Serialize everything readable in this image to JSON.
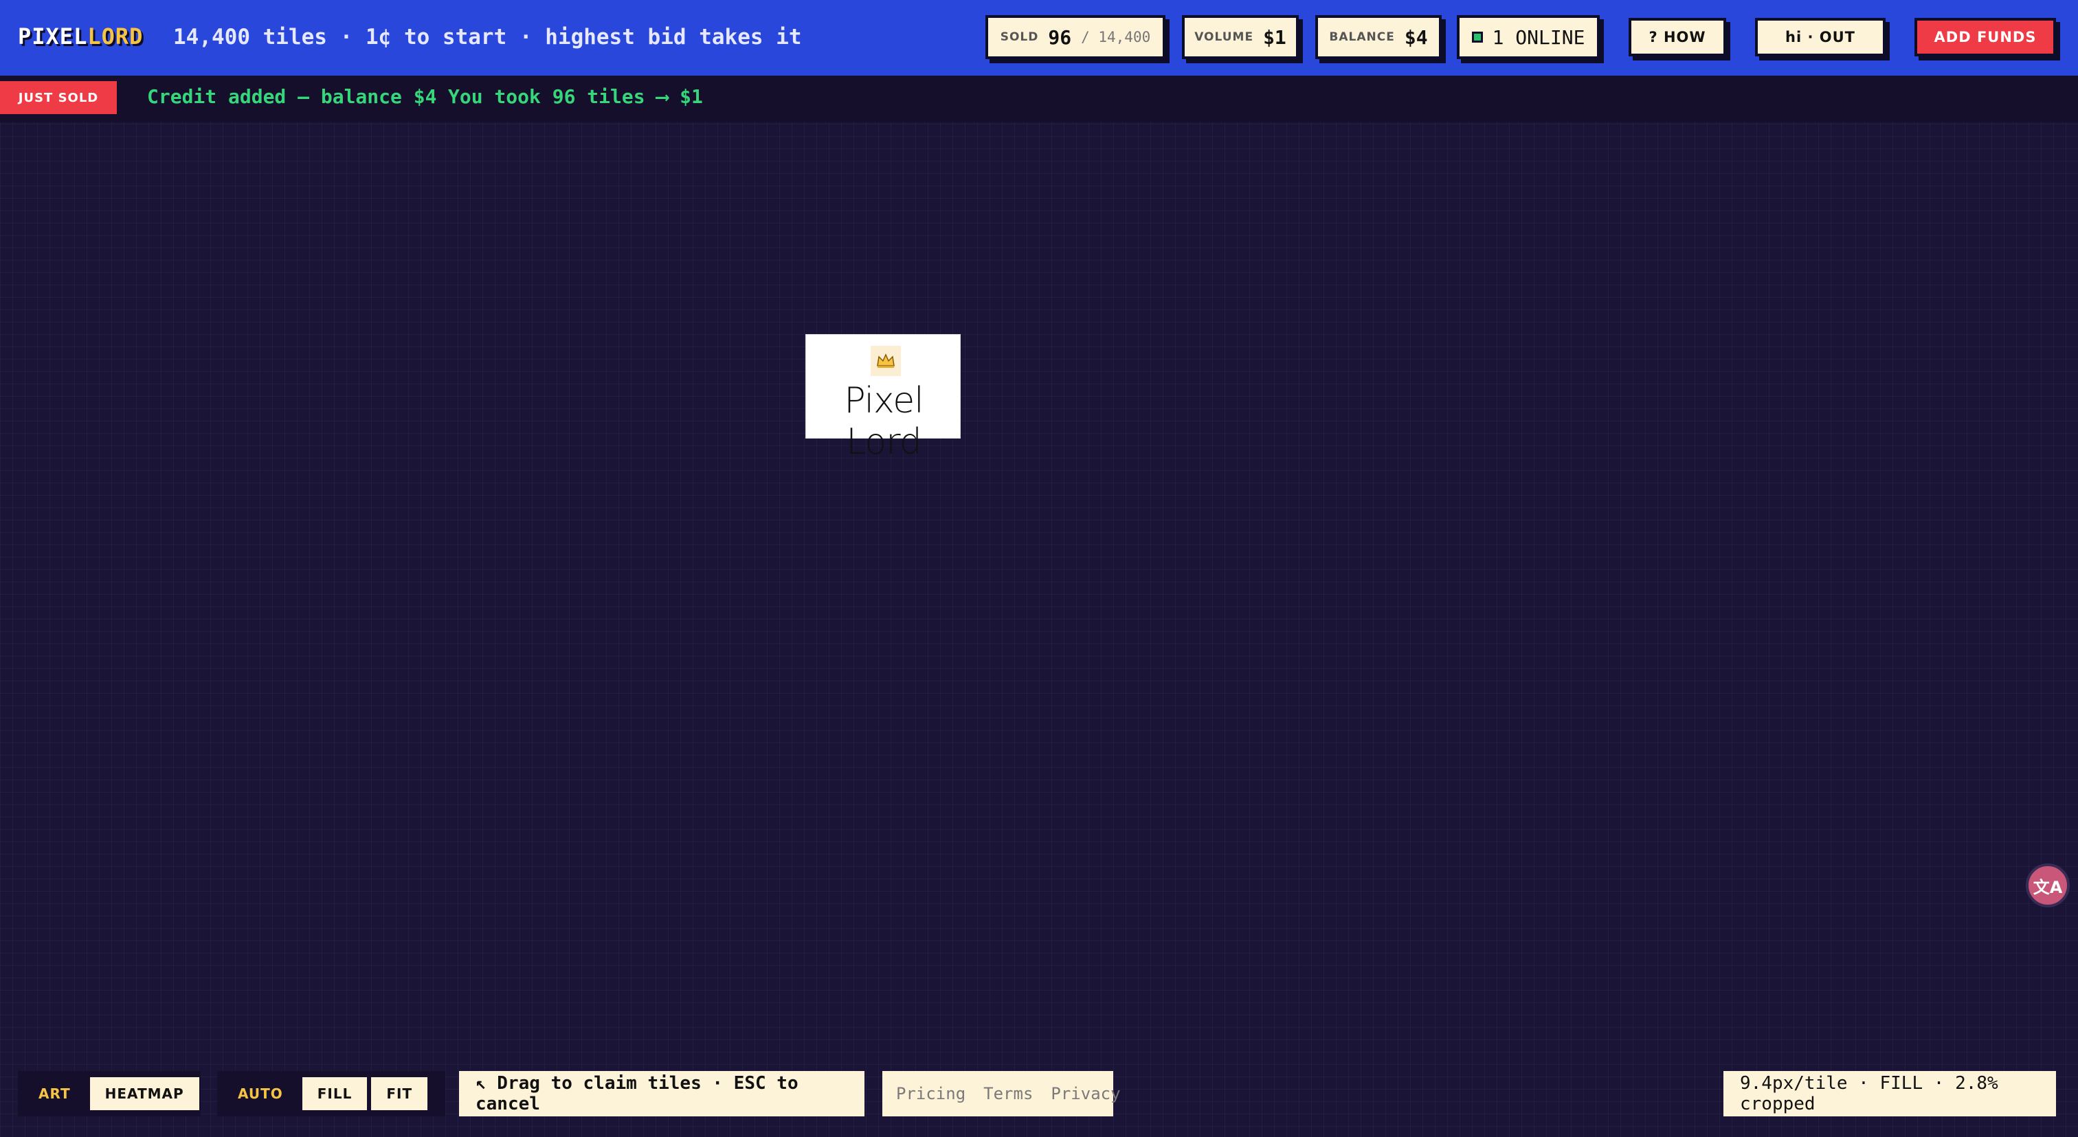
{
  "header": {
    "logo_part1": "PIXEL",
    "logo_part2": "LORD",
    "tagline": "14,400 tiles · 1¢ to start · highest bid takes it",
    "stats": {
      "sold_label": "SOLD",
      "sold_value": "96",
      "sold_total": "/ 14,400",
      "volume_label": "VOLUME",
      "volume_value": "$1",
      "balance_label": "BALANCE",
      "balance_value": "$4",
      "online_label": "1 ONLINE"
    },
    "buttons": {
      "how": "? HOW",
      "user": "hi · OUT",
      "add_funds": "ADD FUNDS"
    }
  },
  "ticker": {
    "badge": "JUST SOLD",
    "messages": [
      "Credit added — balance $4",
      "You took 96 tiles ⟶ $1"
    ]
  },
  "canvas": {
    "tile_text": "Pixel Lord",
    "crown_icon": "crown-icon"
  },
  "bottom": {
    "view_modes": [
      "ART",
      "HEATMAP"
    ],
    "fit_modes": [
      "AUTO",
      "FILL",
      "FIT"
    ],
    "hint": "↖ Drag to claim tiles · ESC to cancel",
    "links": [
      "Pricing",
      "Terms",
      "Privacy"
    ],
    "zoom_status": "9.4px/tile · FILL · 2.8% cropped"
  },
  "colors": {
    "header_bg": "#2a47dc",
    "canvas_bg": "#1a1437",
    "accent_yellow": "#f6c445",
    "accent_red": "#ee3b46",
    "accent_green": "#36d67a",
    "cream": "#fdf3d8"
  }
}
